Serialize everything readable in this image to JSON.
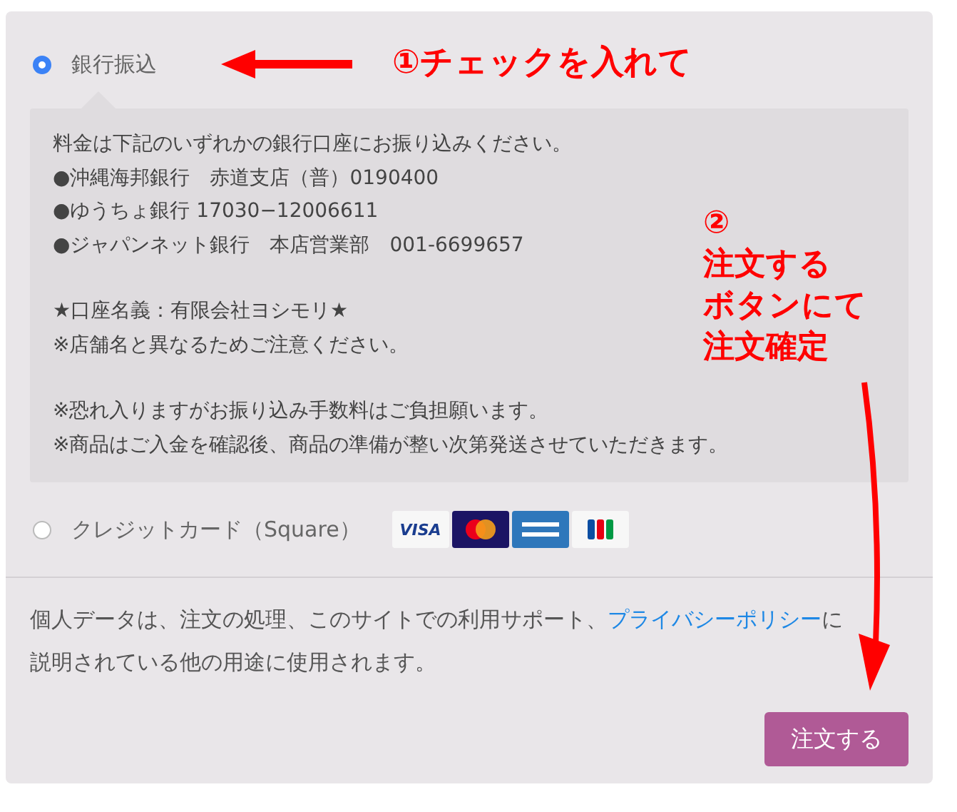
{
  "payment_methods": [
    {
      "label": "銀行振込",
      "selected": true,
      "description": [
        [
          "料金は下記のいずれかの銀行口座にお振り込みください。",
          "●沖縄海邦銀行　赤道支店（普）0190400",
          "●ゆうちょ銀行 17030−12006611",
          "●ジャパンネット銀行　本店営業部　001-6699657"
        ],
        [
          "★口座名義：有限会社ヨシモリ★",
          "※店舗名と異なるためご注意ください。"
        ],
        [
          "※恐れ入りますがお振り込み手数料はご負担願います。",
          "※商品はご入金を確認後、商品の準備が整い次第発送させていただきます。"
        ]
      ]
    },
    {
      "label": "クレジットカード（Square）",
      "selected": false,
      "card_logos": [
        {
          "kind": "visa",
          "text": "VISA"
        },
        {
          "kind": "mastercard"
        },
        {
          "kind": "amex"
        },
        {
          "kind": "jcb"
        }
      ]
    }
  ],
  "privacy": {
    "text": "個人データは、注文の処理、このサイトでの利用サポート、",
    "link": "プライバシーポリシー",
    "text_after": "に説明されている他の用途に使用されます。"
  },
  "order_button": "注文する",
  "annotations": [
    {
      "kind": "arrow_note",
      "text": "①チェックを入れて"
    },
    {
      "kind": "curved_note",
      "lines": [
        "②",
        "注文する",
        "ボタンにて",
        "注文確定"
      ]
    }
  ]
}
